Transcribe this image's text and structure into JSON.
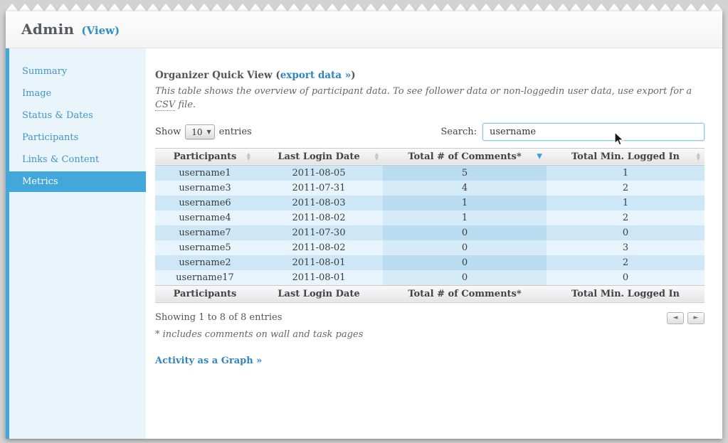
{
  "header": {
    "title": "Admin",
    "view_label": "(View)"
  },
  "sidebar": {
    "items": [
      {
        "label": "Summary"
      },
      {
        "label": "Image"
      },
      {
        "label": "Status & Dates"
      },
      {
        "label": "Participants"
      },
      {
        "label": "Links & Content"
      },
      {
        "label": "Metrics",
        "active": true
      }
    ]
  },
  "main": {
    "title_prefix": "Organizer Quick View (",
    "export_link": "export data »",
    "title_suffix": ")",
    "description_1": "This table shows the overview of participant data. To see follower data or non-loggedin user data, use export for a ",
    "description_csv": "CSV",
    "description_2": " file.",
    "show_label": "Show",
    "page_size": "10",
    "entries_label": "entries",
    "search_label": "Search:",
    "search_value": "username",
    "table": {
      "columns": [
        "Participants",
        "Last Login Date",
        "Total # of Comments*",
        "Total Min. Logged In"
      ],
      "sorted_column_index": 2,
      "sort_direction": "desc",
      "rows": [
        [
          "username1",
          "2011-08-05",
          "5",
          "1"
        ],
        [
          "username3",
          "2011-07-31",
          "4",
          "2"
        ],
        [
          "username6",
          "2011-08-03",
          "1",
          "1"
        ],
        [
          "username4",
          "2011-08-02",
          "1",
          "2"
        ],
        [
          "username7",
          "2011-07-30",
          "0",
          "0"
        ],
        [
          "username5",
          "2011-08-02",
          "0",
          "3"
        ],
        [
          "username2",
          "2011-08-01",
          "0",
          "2"
        ],
        [
          "username17",
          "2011-08-01",
          "0",
          "0"
        ]
      ]
    },
    "showing_text": "Showing 1 to 8 of 8 entries",
    "footnote": "* includes comments on wall and task pages",
    "graph_link": "Activity as a Graph »"
  },
  "icons": {
    "sort_asc": "▲",
    "sort_desc": "▼",
    "sort_active_desc": "▼",
    "select_arrow": "▼",
    "prev": "◄",
    "next": "►"
  },
  "colors": {
    "accent": "#3fa7dc",
    "link": "#2e86bd",
    "row_odd": "#cde7f6",
    "row_even": "#e8f4fb",
    "sorted_odd": "#b9dcf1",
    "sorted_even": "#d5ebf8"
  }
}
